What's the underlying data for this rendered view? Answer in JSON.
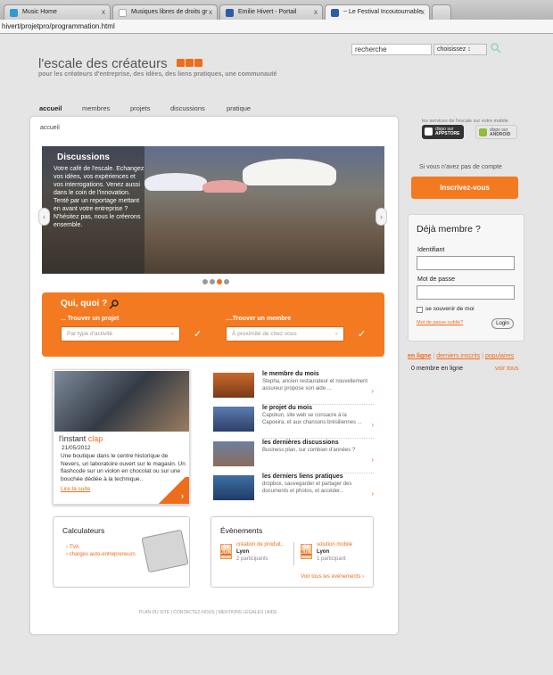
{
  "browser": {
    "tabs": [
      {
        "label": "Music Home",
        "color": "#2e9bd6"
      },
      {
        "label": "Musiques libres de droits gr",
        "color": "#ffffff"
      },
      {
        "label": "Emilie Hivert - Portail",
        "color": "#2c5ba8"
      },
      {
        "label": "~ Le Festival Incoutournable",
        "color": "#2c5ba8"
      }
    ],
    "close_glyph": "x",
    "url": "hivert/projetpro/programmation.html"
  },
  "site": {
    "logo": "l'escale des créateurs",
    "tagline": "pour les créateurs d'entreprise, des idées, des liens pratiques, une communauté",
    "brand_color": "#ee6d1c"
  },
  "search": {
    "value": "recherche",
    "select": "choisissez ↕"
  },
  "nav": [
    "accueil",
    "membres",
    "projets",
    "discussions",
    "pratique"
  ],
  "breadcrumb": "accueil",
  "slider": {
    "title": "Discussions",
    "text": "Votre café de l'escale. Echangez vos idées, vos expériences et vos interrogations. Venez aussi dans le coin de l'innovation. Tenté par un reportage mettant en avant votre entreprise ? N'hésitez pas, nous le créerons ensemble.",
    "prev": "‹",
    "next": "›",
    "dots": 4,
    "active_dot": 3
  },
  "qui": {
    "title": "Qui, quoi ?",
    "left_label": "... Trouver un projet",
    "left_placeholder": "Par type d'activité",
    "right_label": "....Trouver un membre",
    "right_placeholder": "À proximité de chez vous",
    "check": "✓",
    "chevron": "⌄"
  },
  "instant": {
    "title": "l'instant",
    "title_accent": "clap",
    "date": "21/05/2012",
    "text": "Une boutique dans le centre historique de Nevers, un laboratoire ouvert sur le magasin. Un flashcode sur un violon en chocolat ou sur une bouchée dédiée à la technique..",
    "more": "Lire la suite",
    "arrow": "›"
  },
  "features": [
    {
      "title": "le membre du mois",
      "desc": "Stepha, ancien restaurateur et nouvellement assureur propose son aide ..."
    },
    {
      "title": "le projet du mois",
      "desc": "Capokun, site web se consacre à la Capoeira, et aux chansons brésiliennes ..."
    },
    {
      "title": "les dernières discussions",
      "desc": "Business plan, sur combien d'années ?"
    },
    {
      "title": "les derniers liens pratiques",
      "desc": "dropbox, sauvegarder et partager des documents et photos, et accéder.."
    }
  ],
  "feature_arrow": "›",
  "calc": {
    "title": "Calculateurs",
    "links": [
      "TVA",
      "charges auto-entrepreneurs"
    ]
  },
  "events": {
    "title": "Évènements",
    "items": [
      {
        "day": "04",
        "month": "JUIN",
        "title": "création de produit..",
        "city": "Lyon",
        "participants": "2 participants"
      },
      {
        "day": "04",
        "month": "JUIN",
        "title": "solution mobile",
        "city": "Lyon",
        "participants": "1 participant"
      }
    ],
    "all": "Voir tous les évènements  ›"
  },
  "footer": "PLAN DU SITE | CONTACTEZ-NOUS | MENTIONS LÉGALES | AIDE",
  "sidebar": {
    "mobile": "les services de l'escale sur votre mobile",
    "appstore_small": "dispo sur",
    "appstore": "APPSTORE",
    "android_small": "dispo sur",
    "android": "ANDROID",
    "no_account": "Si vous n'avez pas de compte",
    "signup": "Inscrivez-vous",
    "member_title": "Déjà membre ?",
    "id_label": "Identifiant",
    "pwd_label": "Mot de passe",
    "remember": "se souvenir de moi",
    "forgot": "Mot de passe oublié?",
    "login": "Login",
    "tabs": [
      "en ligne",
      "derniers inscrits",
      "populaires"
    ],
    "tab_sep": "|",
    "online_count": "0 membre en ligne",
    "see_all": "voir tous"
  }
}
